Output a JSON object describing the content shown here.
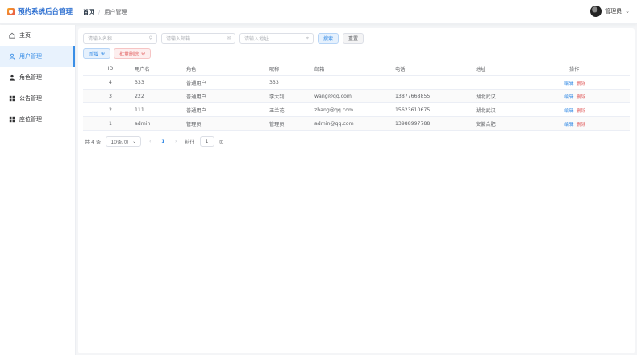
{
  "app": {
    "title": "预约系统后台管理"
  },
  "breadcrumb": {
    "home": "首页",
    "separator": "/",
    "current": "用户管理"
  },
  "user": {
    "name": "管理员"
  },
  "sidebar": {
    "items": [
      {
        "label": "主页",
        "icon": "home-icon",
        "active": false
      },
      {
        "label": "用户管理",
        "icon": "user-icon",
        "active": true
      },
      {
        "label": "角色管理",
        "icon": "role-icon",
        "active": false
      },
      {
        "label": "公告管理",
        "icon": "grid-icon",
        "active": false
      },
      {
        "label": "座位管理",
        "icon": "grid-icon",
        "active": false
      }
    ]
  },
  "filters": {
    "username_placeholder": "请输入名称",
    "email_placeholder": "请输入邮箱",
    "address_placeholder": "请输入地址",
    "search_label": "搜索",
    "reset_label": "重置"
  },
  "actions": {
    "add_label": "新增",
    "batch_delete_label": "批量删除"
  },
  "table": {
    "headers": {
      "id": "ID",
      "username": "用户名",
      "role": "角色",
      "nickname": "昵称",
      "email": "邮箱",
      "phone": "电话",
      "address": "地址",
      "ops": "操作"
    },
    "rows": [
      {
        "id": "4",
        "username": "333",
        "role": "普通用户",
        "nickname": "333",
        "email": "",
        "phone": "",
        "address": ""
      },
      {
        "id": "3",
        "username": "222",
        "role": "普通用户",
        "nickname": "李大钊",
        "email": "wang@qq.com",
        "phone": "13877668855",
        "address": "湖北武汉"
      },
      {
        "id": "2",
        "username": "111",
        "role": "普通用户",
        "nickname": "王兰花",
        "email": "zhang@qq.com",
        "phone": "15623610675",
        "address": "湖北武汉"
      },
      {
        "id": "1",
        "username": "admin",
        "role": "管理员",
        "nickname": "管理员",
        "email": "admin@qq.com",
        "phone": "13988997788",
        "address": "安徽合肥"
      }
    ],
    "edit_label": "编辑",
    "delete_label": "删除"
  },
  "pagination": {
    "total": "共 4 条",
    "page_size": "10条/页",
    "current_page": "1",
    "goto_prefix": "前往",
    "goto_value": "1",
    "goto_suffix": "页"
  },
  "colors": {
    "accent": "#3a8ee6",
    "danger": "#e15f5f",
    "brand": "#2d6fd0"
  }
}
